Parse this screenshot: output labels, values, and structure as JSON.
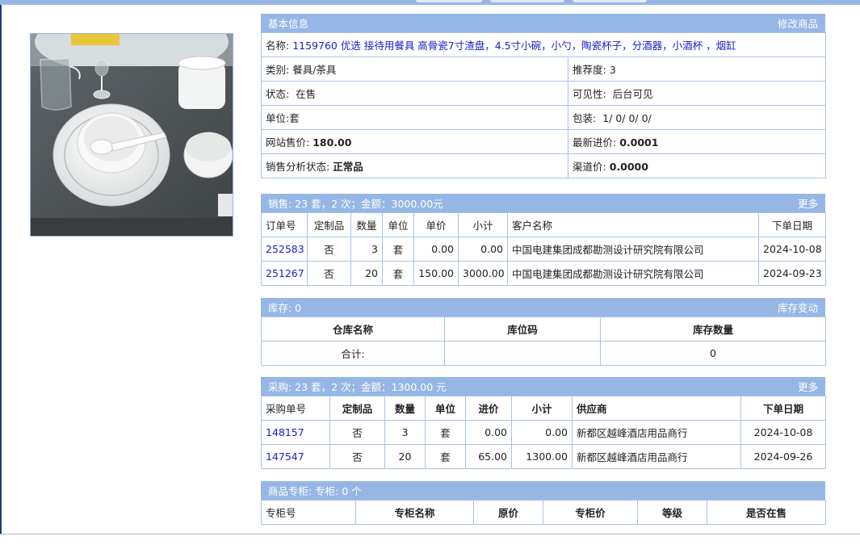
{
  "info": {
    "header": "基本信息",
    "edit_link": "修改商品",
    "name_label": "名称:",
    "name_value": "1159760 优选 接待用餐具 高骨瓷7寸渣盘，4.5寸小碗，小勺，陶瓷杯子，分酒器，小酒杯 ，烟缸",
    "category_label": "类别:",
    "category_value": "餐具/茶具",
    "recommend_label": "推荐度:",
    "recommend_value": "3",
    "status_label": "状态:",
    "status_value": "在售",
    "visibility_label": "可见性:",
    "visibility_value": "后台可见",
    "unit_label": "单位:",
    "unit_value": "套",
    "package_label": "包装:",
    "package_value": "1/ 0/ 0/ 0/",
    "price_label": "网站售价:",
    "price_value": "180.00",
    "last_cost_label": "最新进价:",
    "last_cost_value": "0.0001",
    "analysis_label": "销售分析状态:",
    "analysis_value": "正常品",
    "channel_label": "渠道价:",
    "channel_value": "0.0000"
  },
  "sales": {
    "header": "销售:  23 套，2 次；金额：3000.00元",
    "more": "更多",
    "columns": [
      "订单号",
      "定制品",
      "数量",
      "单位",
      "单价",
      "小计",
      "客户名称",
      "下单日期"
    ],
    "rows": [
      {
        "order": "252583",
        "custom": "否",
        "qty": "3",
        "unit": "套",
        "price": "0.00",
        "subtotal": "0.00",
        "customer": "中国电建集团成都勘测设计研究院有限公司",
        "date": "2024-10-08"
      },
      {
        "order": "251267",
        "custom": "否",
        "qty": "20",
        "unit": "套",
        "price": "150.00",
        "subtotal": "3000.00",
        "customer": "中国电建集团成都勘测设计研究院有限公司",
        "date": "2024-09-23"
      }
    ]
  },
  "stock": {
    "header": "库存:  0",
    "change_link": "库存变动",
    "columns": [
      "仓库名称",
      "库位码",
      "库存数量"
    ],
    "total_label": "合计:",
    "total_value": "0"
  },
  "purchase": {
    "header": "采购:  23 套，2 次；金额：1300.00 元",
    "more": "更多",
    "columns": [
      "采购单号",
      "定制品",
      "数量",
      "单位",
      "进价",
      "小计",
      "供应商",
      "下单日期"
    ],
    "rows": [
      {
        "order": "148157",
        "custom": "否",
        "qty": "3",
        "unit": "套",
        "price": "0.00",
        "subtotal": "0.00",
        "supplier": "新都区越峰酒店用品商行",
        "date": "2024-10-08"
      },
      {
        "order": "147547",
        "custom": "否",
        "qty": "20",
        "unit": "套",
        "price": "65.00",
        "subtotal": "1300.00",
        "supplier": "新都区越峰酒店用品商行",
        "date": "2024-09-26"
      }
    ]
  },
  "counter": {
    "header": "商品专柜:  专柜: 0 个",
    "columns": [
      "专柜号",
      "专柜名称",
      "原价",
      "专柜价",
      "等级",
      "是否在售"
    ]
  }
}
